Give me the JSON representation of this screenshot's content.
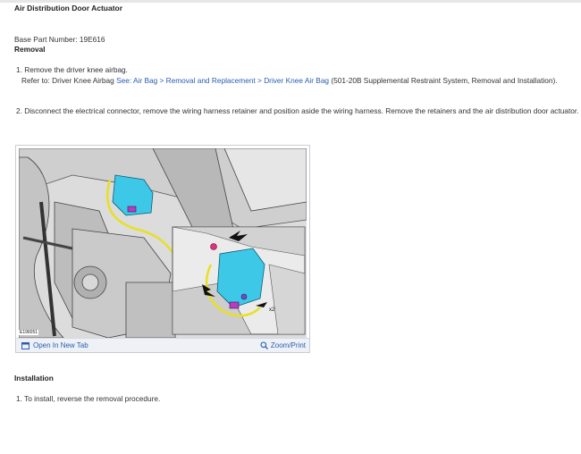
{
  "title": "Air Distribution Door Actuator",
  "base_part": "Base Part Number: 19E616",
  "removal_heading": "Removal",
  "steps": [
    {
      "text": "1. Remove the driver knee airbag.",
      "refer_prefix": "Refer to: Driver Knee Airbag ",
      "refer_link": "See: Air Bag > Removal and Replacement > Driver Knee Air Bag",
      "refer_suffix": " (501-20B Supplemental Restraint System, Removal and Installation)."
    },
    {
      "text": "2. Disconnect the electrical connector, remove the wiring harness retainer and position aside the wiring harness. Remove the retainers and the air distribution door actuator."
    }
  ],
  "figure": {
    "id": "E196051",
    "open_label": "Open In New Tab",
    "zoom_label": "Zoom/Print",
    "callout": "x2"
  },
  "installation_heading": "Installation",
  "install_steps": [
    {
      "text": "1. To install, reverse the removal procedure."
    }
  ],
  "colors": {
    "link": "#2a5db0",
    "actuator": "#3ec8e8",
    "harness": "#e8e020",
    "connector": "#b040c0"
  }
}
